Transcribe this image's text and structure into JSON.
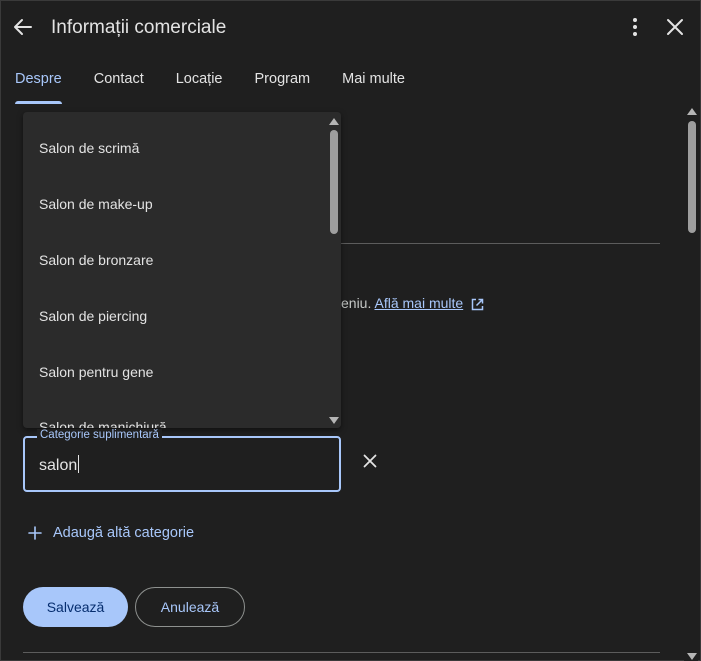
{
  "header": {
    "title": "Informații comerciale",
    "back_icon": "arrow-left-icon",
    "more_icon": "more-vert-icon",
    "close_icon": "close-icon"
  },
  "tabs": [
    {
      "label": "Despre",
      "active": true
    },
    {
      "label": "Contact",
      "active": false
    },
    {
      "label": "Locație",
      "active": false
    },
    {
      "label": "Program",
      "active": false
    },
    {
      "label": "Mai multe",
      "active": false
    }
  ],
  "background_text": {
    "partial_text": "eniu.",
    "learn_more_label": "Află mai multe"
  },
  "dropdown": {
    "items": [
      "Salon de scrimă",
      "Salon de make-up",
      "Salon de bronzare",
      "Salon de piercing",
      "Salon pentru gene",
      "Salon de manichiură"
    ]
  },
  "category_field": {
    "label": "Categorie suplimentară",
    "value": "salon"
  },
  "add_category": {
    "label": "Adaugă altă categorie"
  },
  "actions": {
    "save_label": "Salvează",
    "cancel_label": "Anulează"
  },
  "colors": {
    "background": "#1f1f1f",
    "accent": "#a8c7fa",
    "surface": "#2b2b2b",
    "text": "#e3e3e3"
  }
}
